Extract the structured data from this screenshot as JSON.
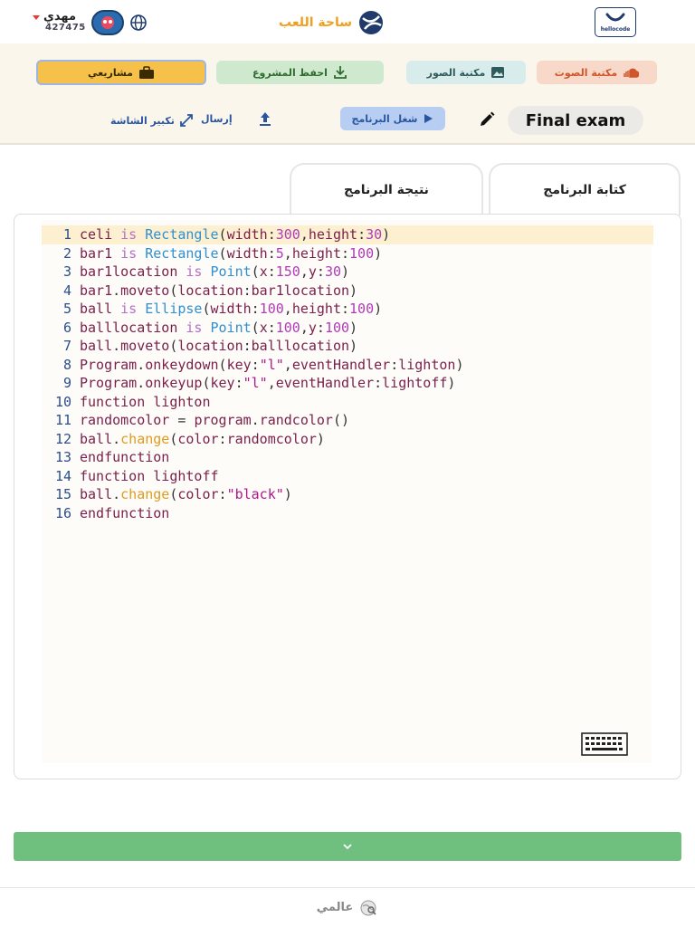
{
  "header": {
    "user_name": "مهدي",
    "user_id": "427475",
    "brand_label": "ساحة اللعب",
    "logo_text": "hellocode"
  },
  "toolbar": {
    "projects_label": "مشاريعي",
    "save_label": "احفظ المشروع",
    "images_label": "مكتبة الصور",
    "sound_label": "مكتبة الصوت",
    "run_label": "شغل البرنامج",
    "fullscreen_label": "تكبير الشاشة",
    "send_label": "إرسال",
    "project_title": "Final exam"
  },
  "tabs": {
    "code": "كتابة البرنامج",
    "result": "نتيجة البرنامج"
  },
  "editor": {
    "lines": [
      "celi is Rectangle(width:300,height:30)",
      "bar1 is Rectangle(width:5,height:100)",
      "bar1location is Point(x:150,y:30)",
      "bar1.moveto(location:bar1location)",
      "ball is Ellipse(width:100,height:100)",
      "balllocation is Point(x:100,y:100)",
      "ball.moveto(location:balllocation)",
      "Program.onkeydown(key:\"l\",eventHandler:lighton)",
      "Program.onkeyup(key:\"l\",eventHandler:lightoff)",
      "function lighton",
      "randomcolor = program.randcolor()",
      "ball.change(color:randomcolor)",
      "endfunction",
      "function lightoff",
      "ball.change(color:\"black\")",
      "endfunction"
    ],
    "active_line": 1
  },
  "footer": {
    "label": "عالمي"
  },
  "colors": {
    "accent_yellow": "#f5c14a",
    "run_blue": "#b7cdf2",
    "green_bar": "#6fc07f"
  }
}
